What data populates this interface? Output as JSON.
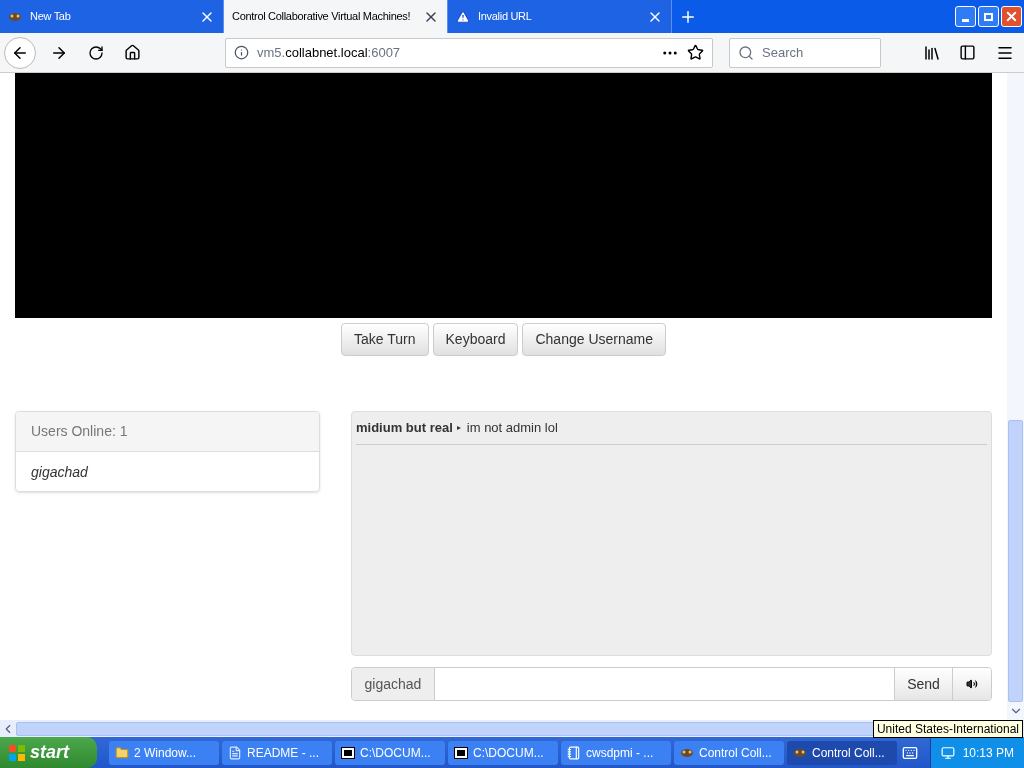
{
  "tabs": [
    {
      "label": "New Tab",
      "kind": "app",
      "selected": false
    },
    {
      "label": "Control Collaborative Virtual Machines!",
      "kind": "plain",
      "selected": true
    },
    {
      "label": "Invalid URL",
      "kind": "warning",
      "selected": false
    }
  ],
  "address": {
    "host_prefix": "vm5.",
    "host": "collabnet.local",
    "port": ":6007"
  },
  "search": {
    "placeholder": "Search"
  },
  "vm_buttons": [
    "Take Turn",
    "Keyboard",
    "Change Username"
  ],
  "users": {
    "heading": "Users Online: 1",
    "list": [
      "gigachad"
    ]
  },
  "chat": {
    "messages": [
      {
        "user": "midium but real",
        "arrow": "▸",
        "text": "im not admin lol"
      }
    ]
  },
  "chat_input": {
    "username": "gigachad",
    "send": "Send"
  },
  "tooltip": "United States-International",
  "taskbar": {
    "start": "start",
    "items": [
      {
        "label": "2 Window...",
        "kind": "folder",
        "selected": false
      },
      {
        "label": "README - ...",
        "kind": "doc",
        "selected": false
      },
      {
        "label": "C:\\DOCUM...",
        "kind": "zip",
        "selected": false
      },
      {
        "label": "C:\\DOCUM...",
        "kind": "zip",
        "selected": false
      },
      {
        "label": "cwsdpmi - ...",
        "kind": "notepad",
        "selected": false
      },
      {
        "label": "Control Coll...",
        "kind": "app",
        "selected": false
      },
      {
        "label": "Control Coll...",
        "kind": "app",
        "selected": true
      }
    ],
    "clock": "10:13 PM"
  }
}
